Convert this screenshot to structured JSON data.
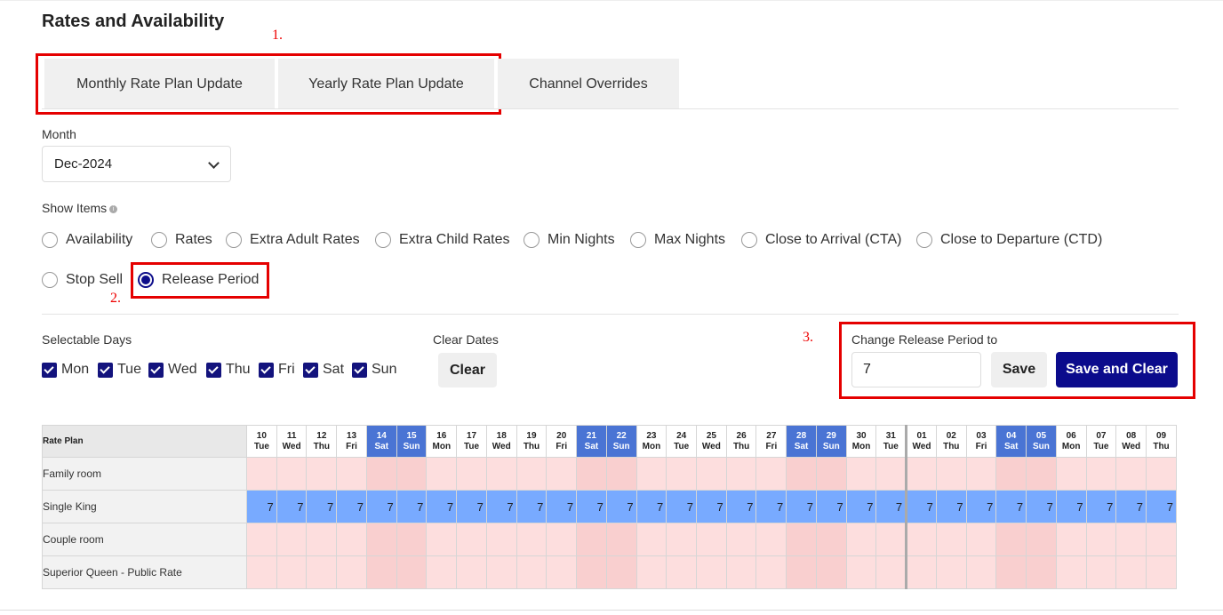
{
  "page": {
    "title": "Rates and Availability"
  },
  "annotations": {
    "a1": "1.",
    "a2": "2.",
    "a3": "3."
  },
  "tabs": [
    "Monthly Rate Plan Update",
    "Yearly Rate Plan Update",
    "Channel Overrides"
  ],
  "month": {
    "label": "Month",
    "value": "Dec-2024"
  },
  "show_items": {
    "label": "Show Items",
    "options": [
      "Availability",
      "Rates",
      "Extra Adult Rates",
      "Extra Child Rates",
      "Min Nights",
      "Max Nights",
      "Close to Arrival (CTA)",
      "Close to Departure (CTD)",
      "Stop Sell",
      "Release Period"
    ],
    "selected": "Release Period"
  },
  "selectable_days": {
    "label": "Selectable Days",
    "days": [
      "Mon",
      "Tue",
      "Wed",
      "Thu",
      "Fri",
      "Sat",
      "Sun"
    ]
  },
  "clear_dates": {
    "label": "Clear Dates",
    "button": "Clear"
  },
  "release": {
    "label": "Change Release Period to",
    "value": "7",
    "save": "Save",
    "save_clear": "Save and Clear"
  },
  "grid": {
    "header_label": "Rate Plan",
    "dates": [
      {
        "d": "10",
        "w": "Tue"
      },
      {
        "d": "11",
        "w": "Wed"
      },
      {
        "d": "12",
        "w": "Thu"
      },
      {
        "d": "13",
        "w": "Fri"
      },
      {
        "d": "14",
        "w": "Sat"
      },
      {
        "d": "15",
        "w": "Sun"
      },
      {
        "d": "16",
        "w": "Mon"
      },
      {
        "d": "17",
        "w": "Tue"
      },
      {
        "d": "18",
        "w": "Wed"
      },
      {
        "d": "19",
        "w": "Thu"
      },
      {
        "d": "20",
        "w": "Fri"
      },
      {
        "d": "21",
        "w": "Sat"
      },
      {
        "d": "22",
        "w": "Sun"
      },
      {
        "d": "23",
        "w": "Mon"
      },
      {
        "d": "24",
        "w": "Tue"
      },
      {
        "d": "25",
        "w": "Wed"
      },
      {
        "d": "26",
        "w": "Thu"
      },
      {
        "d": "27",
        "w": "Fri"
      },
      {
        "d": "28",
        "w": "Sat"
      },
      {
        "d": "29",
        "w": "Sun"
      },
      {
        "d": "30",
        "w": "Mon"
      },
      {
        "d": "31",
        "w": "Tue"
      },
      {
        "d": "01",
        "w": "Wed"
      },
      {
        "d": "02",
        "w": "Thu"
      },
      {
        "d": "03",
        "w": "Fri"
      },
      {
        "d": "04",
        "w": "Sat"
      },
      {
        "d": "05",
        "w": "Sun"
      },
      {
        "d": "06",
        "w": "Mon"
      },
      {
        "d": "07",
        "w": "Tue"
      },
      {
        "d": "08",
        "w": "Wed"
      },
      {
        "d": "09",
        "w": "Thu"
      }
    ],
    "rows": [
      {
        "name": "Family room",
        "value": ""
      },
      {
        "name": "Single King",
        "value": "7"
      },
      {
        "name": "Couple room",
        "value": ""
      },
      {
        "name": "Superior Queen - Public Rate",
        "value": ""
      }
    ],
    "colors": {
      "weekend_header": "#4a74d4",
      "cell": "#fddede",
      "weekend_cell": "#f9cfcf",
      "highlight": "#78aaff"
    }
  }
}
